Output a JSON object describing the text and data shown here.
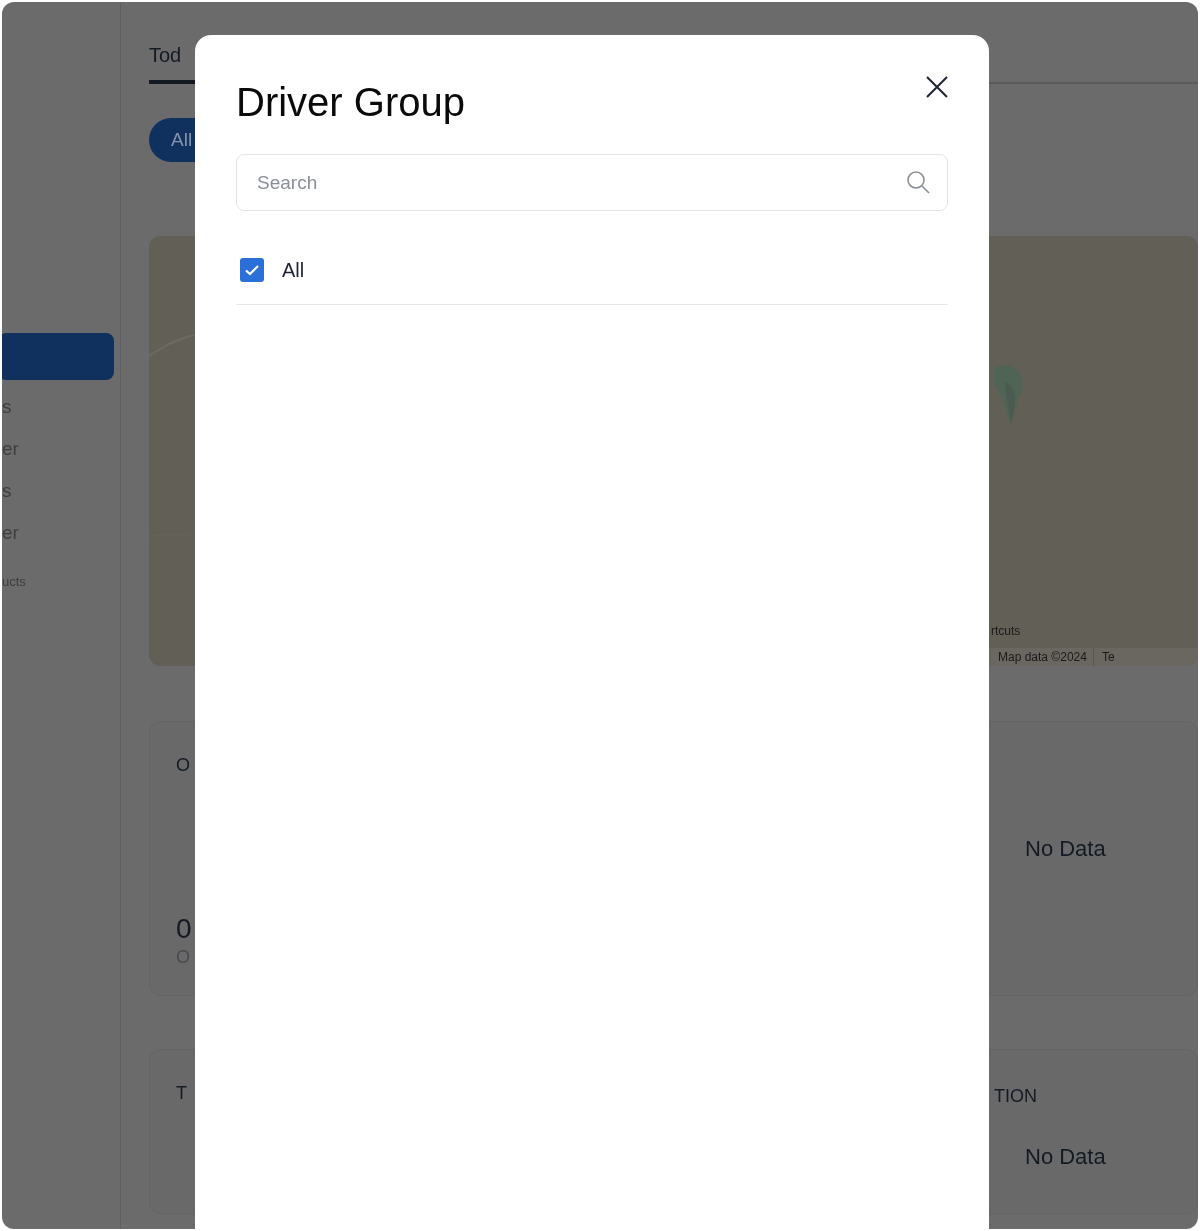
{
  "sidebar": {
    "items": [
      {
        "kind": "item",
        "selected": true
      },
      {
        "kind": "item",
        "label": "s",
        "selected": false
      },
      {
        "kind": "item",
        "label": "er",
        "selected": false
      },
      {
        "kind": "item",
        "label": "s",
        "selected": false
      },
      {
        "kind": "item",
        "label": "er",
        "selected": false
      },
      {
        "kind": "caption",
        "label": "ucts",
        "selected": false
      }
    ]
  },
  "tabs": [
    {
      "label": "Tod",
      "selected": true
    }
  ],
  "filter_chips": [
    {
      "label": "All",
      "selected": true
    }
  ],
  "map": {
    "kind": "picture",
    "shortcuts_link": "rtcuts",
    "attribution": "Map data ©2024",
    "terms_link": "Te"
  },
  "cards": [
    [
      {
        "title": "O",
        "value": "0",
        "caption": "O"
      },
      {
        "empty_text": "No Data"
      }
    ],
    [
      {
        "title": "T"
      },
      {
        "title": "TION",
        "empty_text": "No Data"
      }
    ]
  ],
  "modal": {
    "title": "Driver Group",
    "search": {
      "placeholder": "Search"
    },
    "options": [
      {
        "label": "All",
        "checked": true
      }
    ]
  }
}
